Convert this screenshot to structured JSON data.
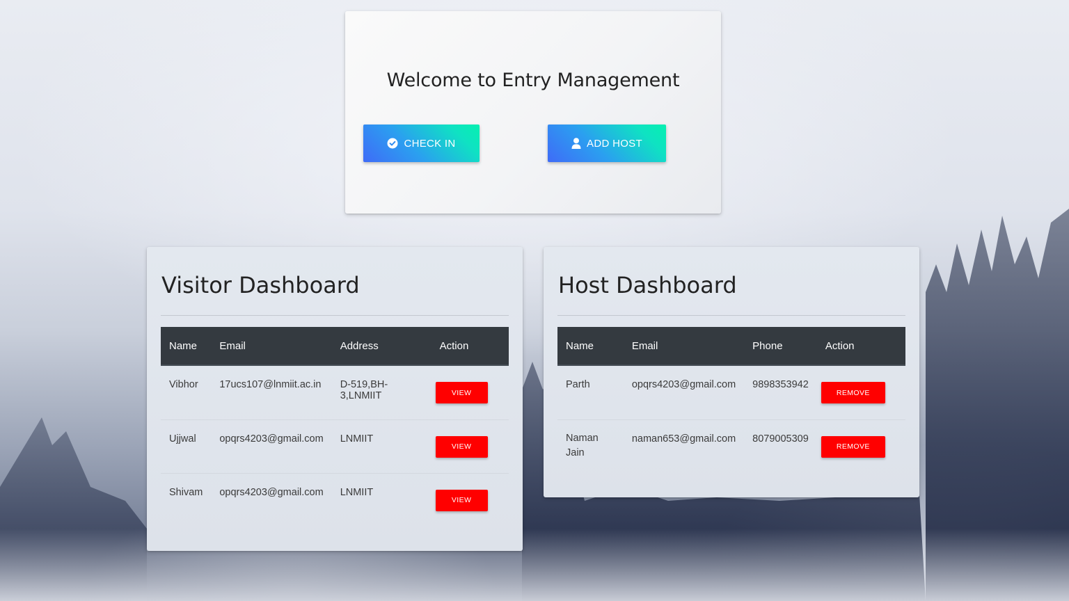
{
  "welcome": {
    "title": "Welcome to Entry Management",
    "checkin_label": "CHECK IN",
    "addhost_label": "ADD HOST"
  },
  "visitor_dashboard": {
    "title": "Visitor Dashboard",
    "columns": [
      "Name",
      "Email",
      "Address",
      "Action"
    ],
    "rows": [
      {
        "name": "Vibhor",
        "email": "17ucs107@lnmiit.ac.in",
        "address": "D-519,BH-3,LNMIIT",
        "action": "VIEW"
      },
      {
        "name": "Ujjwal",
        "email": "opqrs4203@gmail.com",
        "address": "LNMIIT",
        "action": "VIEW"
      },
      {
        "name": "Shivam",
        "email": "opqrs4203@gmail.com",
        "address": "LNMIIT",
        "action": "VIEW"
      }
    ]
  },
  "host_dashboard": {
    "title": "Host Dashboard",
    "columns": [
      "Name",
      "Email",
      "Phone",
      "Action"
    ],
    "rows": [
      {
        "name": "Parth",
        "email": "opqrs4203@gmail.com",
        "phone": "9898353942",
        "action": "REMOVE"
      },
      {
        "name": "Naman Jain",
        "email": "naman653@gmail.com",
        "phone": "8079005309",
        "action": "REMOVE"
      }
    ]
  },
  "colors": {
    "button_gradient_start": "#3f6bf7",
    "button_gradient_end": "#06f0b0",
    "danger": "#ff0000",
    "table_header": "#343a40"
  },
  "icons": {
    "checkin": "check-circle-icon",
    "addhost": "user-icon"
  }
}
